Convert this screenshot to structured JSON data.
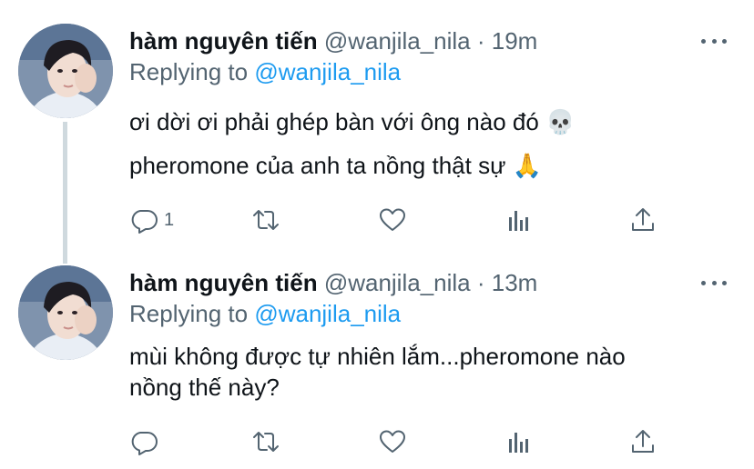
{
  "tweets": [
    {
      "name": "hàm nguyên tiến",
      "handle": "@wanjila_nila",
      "separator": "·",
      "time": "19m",
      "replying_prefix": "Replying to",
      "replying_to": "@wanjila_nila",
      "lines": [
        "ơi dời ơi phải ghép bàn với ông nào đó 💀",
        "pheromone của anh ta nồng thật sự 🙏"
      ],
      "reply_count": "1",
      "icons": [
        "comment-icon",
        "retweet-icon",
        "like-icon",
        "analytics-icon",
        "share-icon"
      ]
    },
    {
      "name": "hàm nguyên tiến",
      "handle": "@wanjila_nila",
      "separator": "·",
      "time": "13m",
      "replying_prefix": "Replying to",
      "replying_to": "@wanjila_nila",
      "lines": [
        "mùi không được tự nhiên lắm...pheromone nào",
        "nồng thế này?"
      ],
      "reply_count": "",
      "icons": [
        "comment-icon",
        "retweet-icon",
        "like-icon",
        "analytics-icon",
        "share-icon"
      ]
    }
  ],
  "colors": {
    "text": "#0f1419",
    "muted": "#536471",
    "link": "#1d9bf0",
    "thread_line": "#cfd9de"
  }
}
